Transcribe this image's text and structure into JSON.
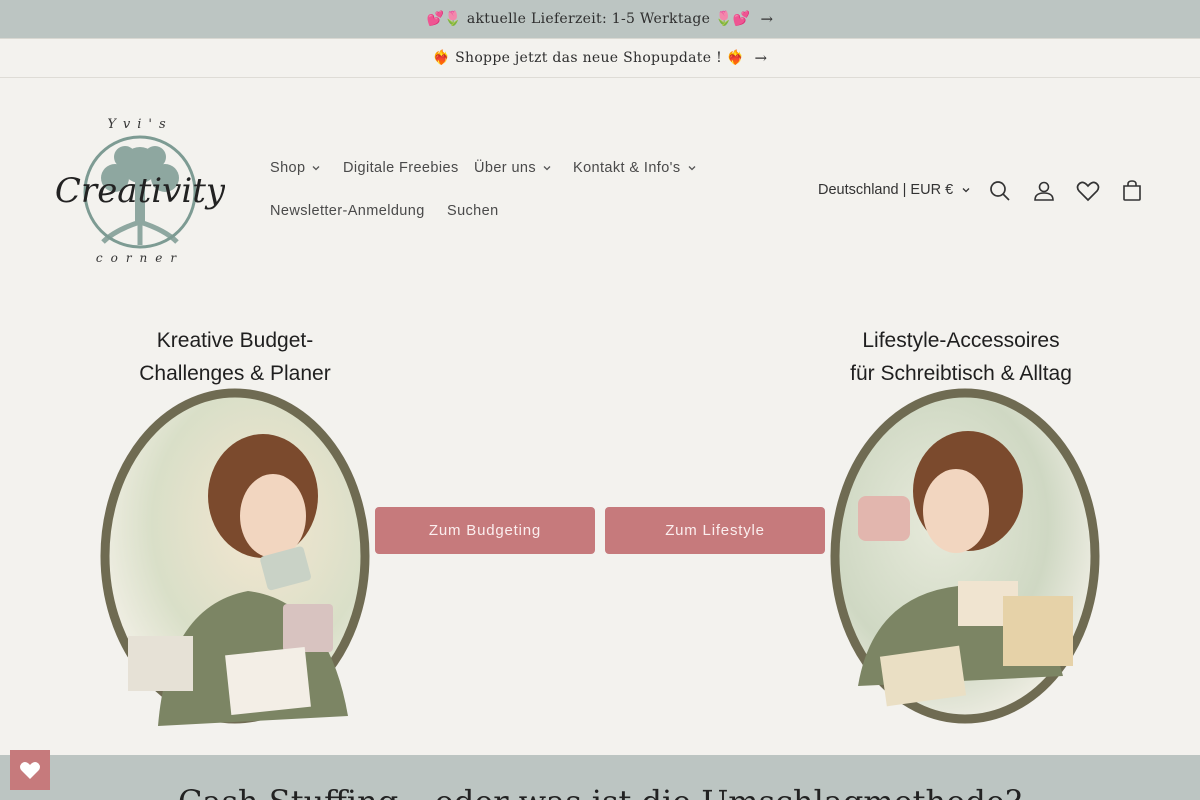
{
  "announcements": [
    {
      "text": "💕🌷 aktuelle Lieferzeit: 1-5 Werktage 🌷💕",
      "arrow": "→"
    },
    {
      "text": "❤️‍🔥 Shoppe jetzt das neue Shopupdate ! ❤️‍🔥",
      "arrow": "→"
    }
  ],
  "logo": {
    "top_text": "Yvi's",
    "script_text": "Creativity",
    "bottom_text": "corner"
  },
  "nav": [
    {
      "label": "Shop",
      "dropdown": true
    },
    {
      "label": "Digitale Freebies",
      "dropdown": false
    },
    {
      "label": "Über uns",
      "dropdown": true
    },
    {
      "label": "Kontakt & Info's",
      "dropdown": true
    },
    {
      "label": "Newsletter-Anmeldung",
      "dropdown": false
    },
    {
      "label": "Suchen",
      "dropdown": false
    }
  ],
  "header": {
    "locale": "Deutschland | EUR €",
    "icons": [
      "search-icon",
      "account-icon",
      "heart-icon",
      "cart-icon"
    ]
  },
  "hero": {
    "left_title_line1": "Kreative Budget-",
    "left_title_line2": "Challenges & Planer",
    "right_title_line1": "Lifestyle-Accessoires",
    "right_title_line2": "für Schreibtisch & Alltag",
    "button_left": "Zum Budgeting",
    "button_right": "Zum Lifestyle"
  },
  "section": {
    "heading": "Cash Stuffing – oder was ist die Umschlagmethode?"
  },
  "colors": {
    "accent": "#c67a7c",
    "bar": "#bcc5c2",
    "background": "#f3f2ee",
    "oval_border": "#6f6b52"
  }
}
